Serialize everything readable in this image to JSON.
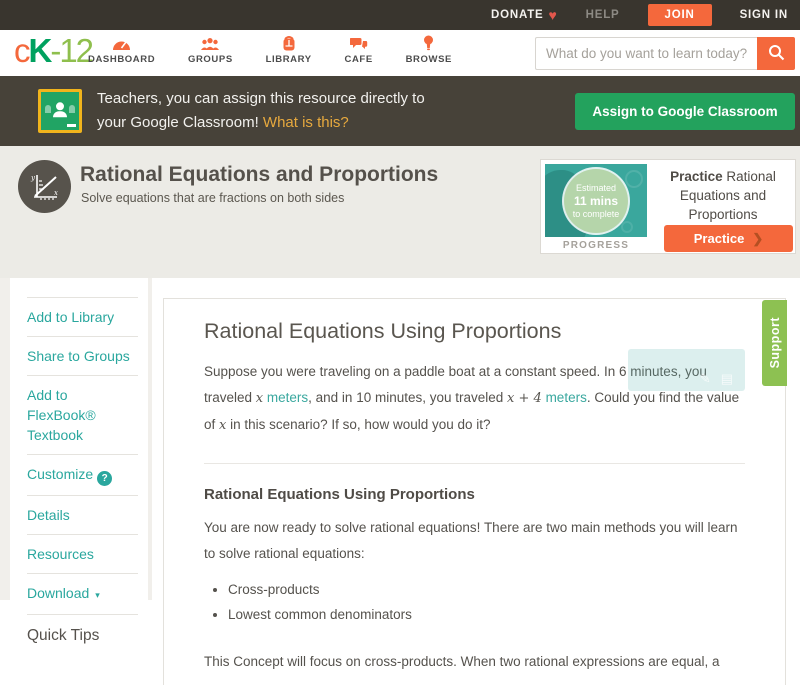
{
  "topbar": {
    "donate_label": "DONATE",
    "help_label": "HELP",
    "join_label": "JOIN",
    "signin_label": "SIGN IN"
  },
  "navbar": {
    "logo": {
      "c": "c",
      "k": "K",
      "suffix": "-12"
    },
    "items": [
      {
        "label": "DASHBOARD"
      },
      {
        "label": "GROUPS"
      },
      {
        "label": "LIBRARY"
      },
      {
        "label": "CAFE"
      },
      {
        "label": "BROWSE"
      }
    ],
    "search": {
      "placeholder": "What do you want to learn today?"
    }
  },
  "classroom_banner": {
    "line1": "Teachers, you can assign this resource directly to",
    "line2": "your Google Classroom!",
    "link": "What is this?",
    "button": "Assign to Google Classroom"
  },
  "lesson_header": {
    "title": "Rational Equations and Proportions",
    "subtitle": "Solve equations that are fractions on both sides"
  },
  "practice_widget": {
    "badge_line1": "Estimated",
    "badge_line2": "11 mins",
    "badge_line3": "to complete",
    "progress_label": "PROGRESS",
    "title_bold": "Practice",
    "title_rest": " Rational Equations and Proportions",
    "button": "Practice",
    "button_arrow": "❯"
  },
  "sidebar": {
    "items": [
      {
        "label": "Add to Library"
      },
      {
        "label": "Share to Groups"
      },
      {
        "label": "Add to FlexBook® Textbook"
      }
    ],
    "customize_label": "Customize",
    "customize_badge": "?",
    "details_label": "Details",
    "resources_label": "Resources",
    "download_label": "Download",
    "download_caret": "▾",
    "quick_tips_label": "Quick Tips"
  },
  "support_tab": {
    "label": "Support"
  },
  "article": {
    "h1": "Rational Equations Using Proportions",
    "p1": {
      "s1": "Suppose you were traveling on a paddle boat at a constant speed. In 6 minutes, you traveled ",
      "math1": "x",
      "s2": " ",
      "link1": "meters",
      "s3": ", and in 10 minutes, you traveled ",
      "math2": "x + 4",
      "s4": " ",
      "link2": "meters",
      "s5": ". Could you find the value of ",
      "math3": "x",
      "s6": " in this scenario? If so, how would you do it?"
    },
    "h2": "Rational Equations Using Proportions",
    "p2": "You are now ready to solve rational equations! There are two main methods you will learn to solve rational equations:",
    "bullets": [
      {
        "text": "Cross-products"
      },
      {
        "text": "Lowest common denominators"
      }
    ],
    "p3": "This Concept will focus on cross-products. When two rational expressions are equal, a"
  },
  "colors": {
    "accent_orange": "#f4683c",
    "teal_link": "#2aa79e",
    "google_green": "#23a25d",
    "support_green": "#8dc152",
    "topbar_bg": "#39352e",
    "banner_bg": "#474239"
  }
}
